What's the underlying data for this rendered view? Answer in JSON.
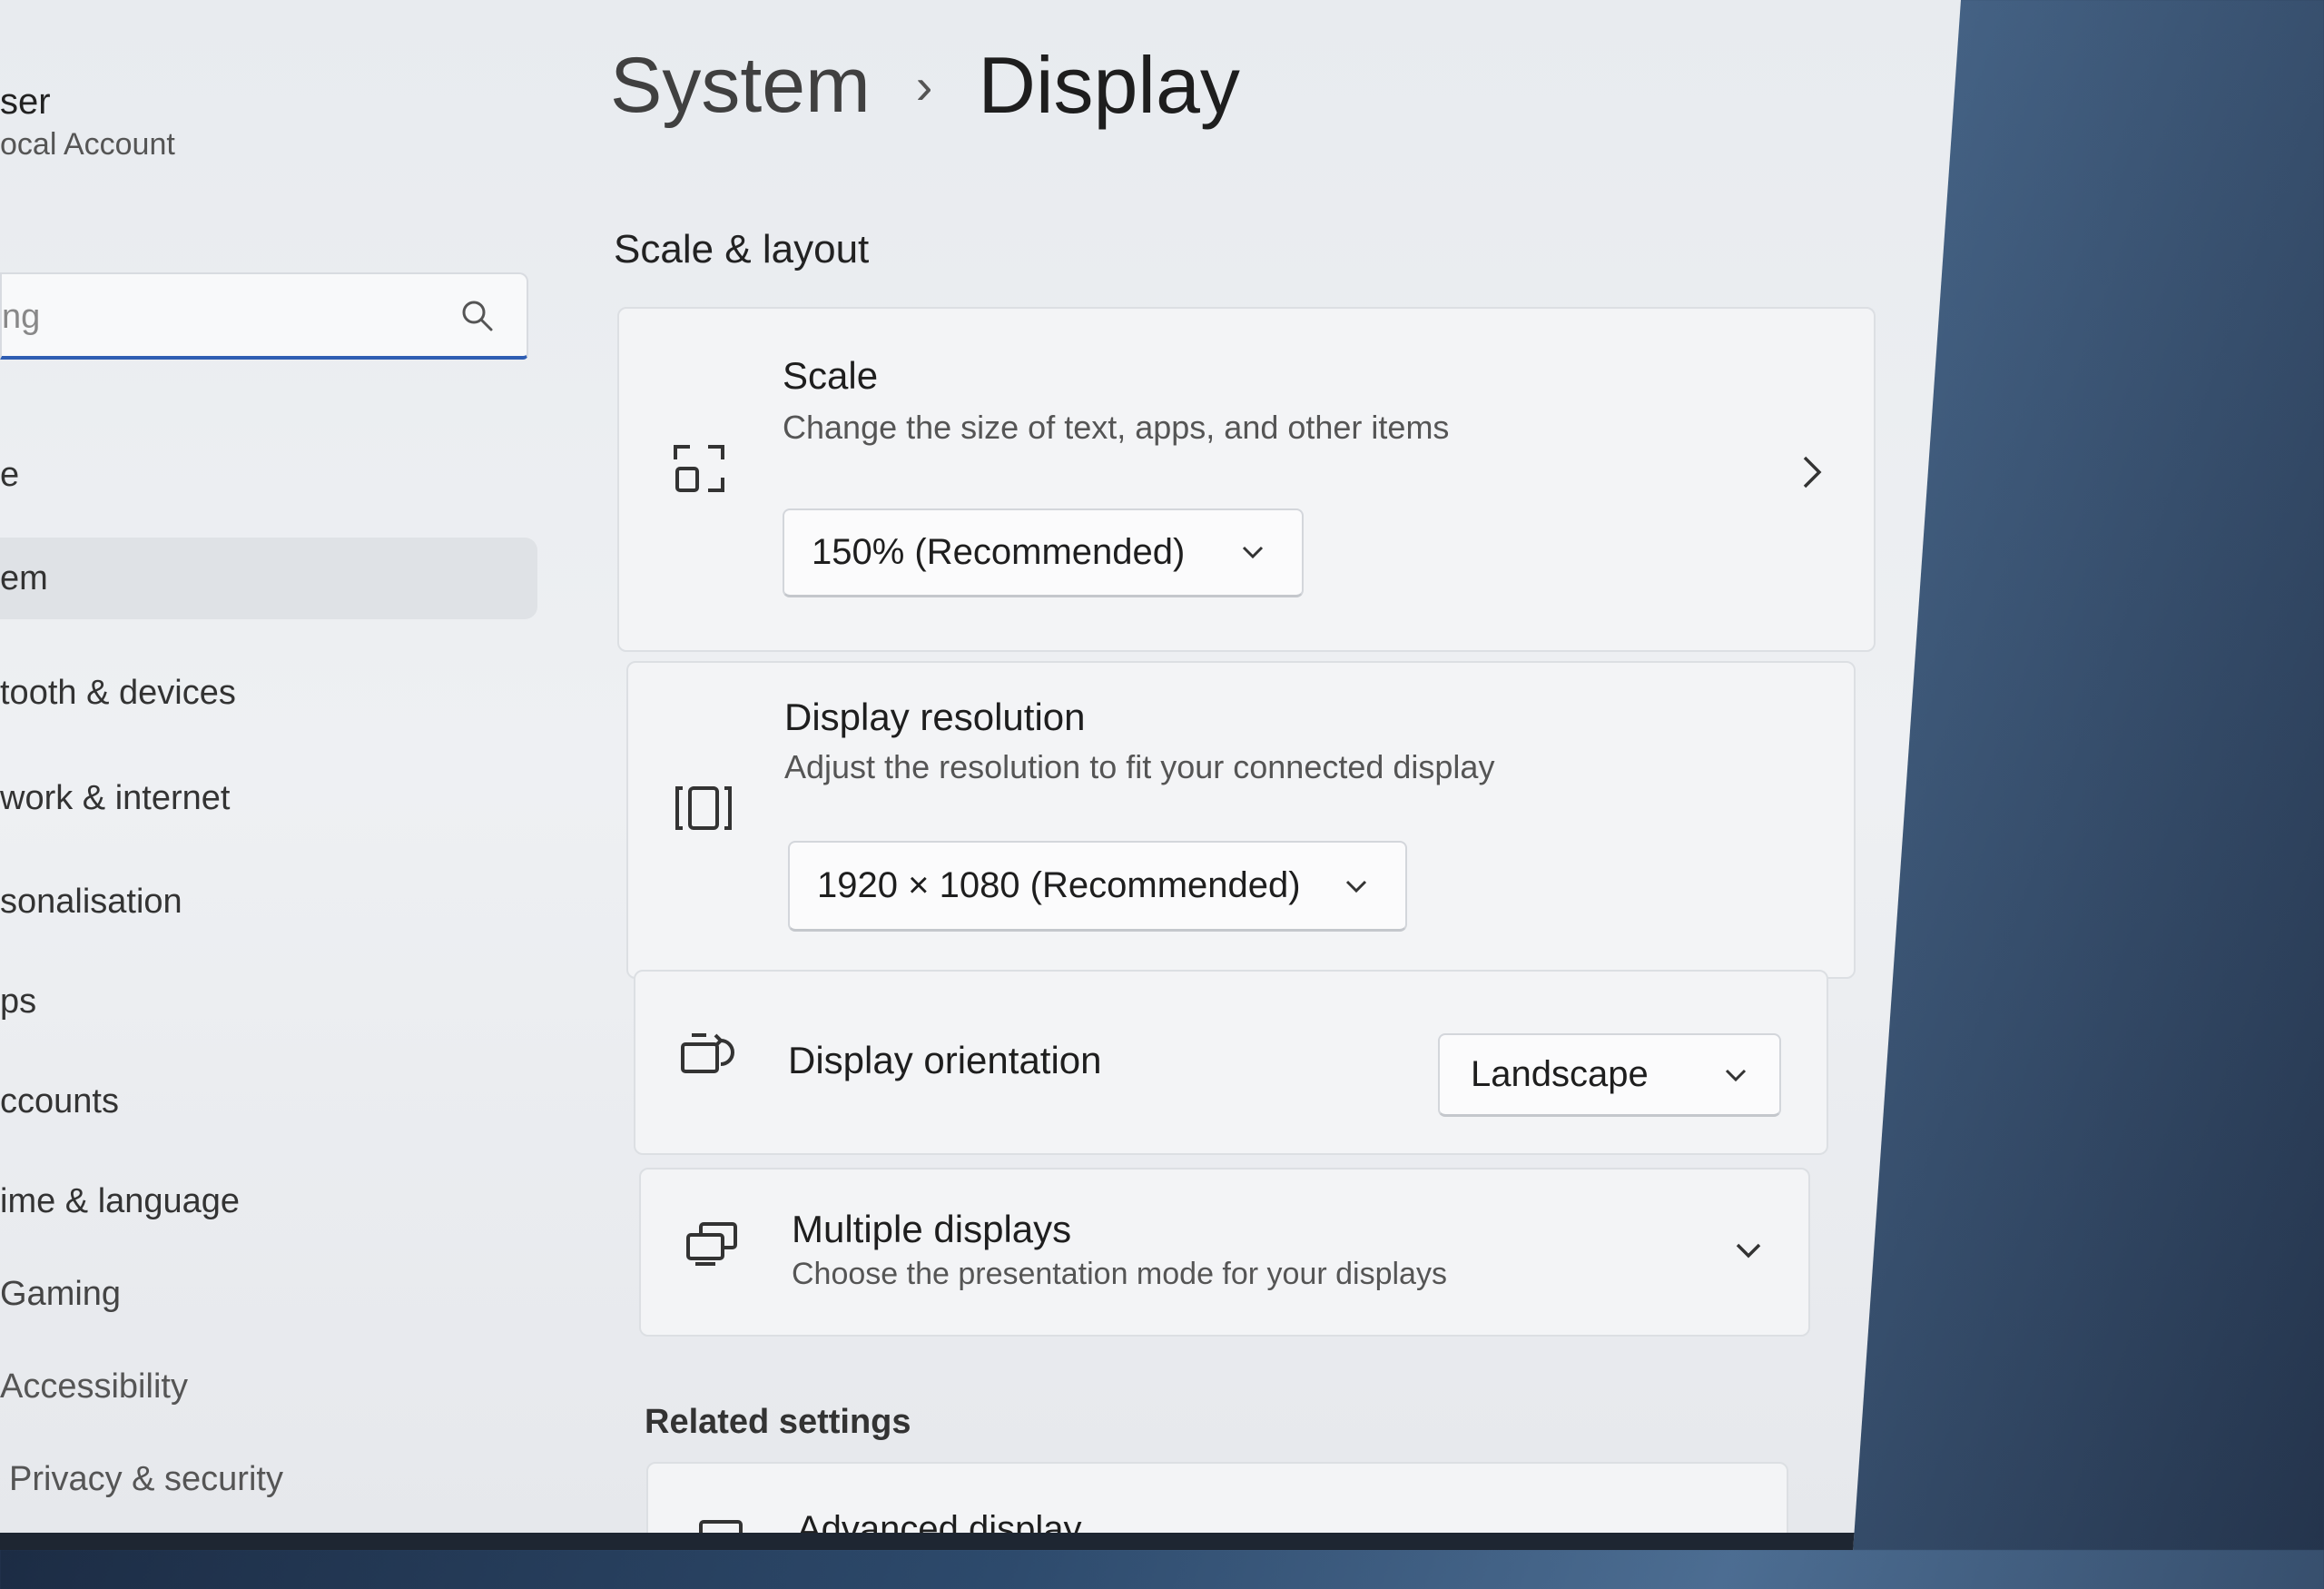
{
  "user": {
    "name": "ser",
    "account": "ocal Account"
  },
  "search": {
    "text": "ng"
  },
  "sidebar": {
    "items": [
      {
        "label": "e",
        "active": false
      },
      {
        "label": "em",
        "active": true
      },
      {
        "label": "tooth & devices",
        "active": false
      },
      {
        "label": "work & internet",
        "active": false
      },
      {
        "label": "sonalisation",
        "active": false
      },
      {
        "label": "ps",
        "active": false
      },
      {
        "label": "ccounts",
        "active": false
      },
      {
        "label": "ime & language",
        "active": false
      },
      {
        "label": "Gaming",
        "active": false
      },
      {
        "label": "Accessibility",
        "active": false
      },
      {
        "label": "Privacy & security",
        "active": false
      }
    ]
  },
  "breadcrumb": {
    "parent": "System",
    "separator": "›",
    "current": "Display"
  },
  "section": {
    "title": "Scale & layout"
  },
  "scale": {
    "title": "Scale",
    "description": "Change the size of text, apps, and other items",
    "value": "150% (Recommended)"
  },
  "resolution": {
    "title": "Display resolution",
    "description": "Adjust the resolution to fit your connected display",
    "value": "1920 × 1080 (Recommended)"
  },
  "orientation": {
    "title": "Display orientation",
    "value": "Landscape"
  },
  "multiple": {
    "title": "Multiple displays",
    "description": "Choose the presentation mode for your displays"
  },
  "related": {
    "title": "Related settings"
  },
  "advanced": {
    "title": "Advanced display"
  },
  "colors": {
    "accent": "#2f5eb3"
  }
}
